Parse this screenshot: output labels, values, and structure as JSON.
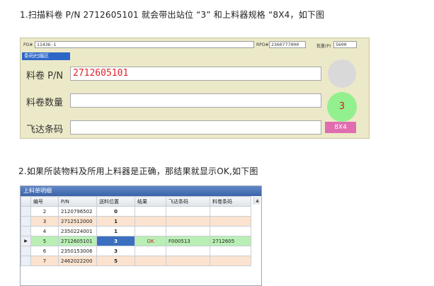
{
  "captions": {
    "step1": "1.扫描料卷 P/N 2712605101 就会带出站位 “3” 和上料器规格 “8X4，如下图",
    "step2": "2.如果所装物料及所用上料器是正确，那结果就显示OK,如下图"
  },
  "scan_panel": {
    "topbar": {
      "po_label": "PO#",
      "po_value": "11436-1",
      "rpo_label": "RPO#",
      "rpo_value": "2360777000",
      "qty_label": "批量(P)",
      "qty_value": "5600"
    },
    "section_tag": "条码扫描区",
    "fields": {
      "reel_pn_label": "料卷 P/N",
      "reel_pn_value": "2712605101",
      "reel_qty_label": "料卷数量",
      "reel_qty_value": "",
      "feeder_code_label": "飞达条码",
      "feeder_code_value": ""
    },
    "station_value": "3",
    "feeder_spec": "8X4",
    "colors": {
      "station_circle": "#93f08e",
      "spec_badge": "#e06db0",
      "section_tag": "#2e66c8"
    }
  },
  "detail_grid": {
    "title": "上料单明细",
    "columns": [
      "编号",
      "P/N",
      "送料位置",
      "结果",
      "飞达条码",
      "料卷条码"
    ],
    "rows": [
      {
        "no": "2",
        "pn": "2120796502",
        "pos": "0",
        "result": "",
        "feeder": "",
        "reel": "",
        "marker": ""
      },
      {
        "no": "3",
        "pn": "2712512000",
        "pos": "1",
        "result": "",
        "feeder": "",
        "reel": "",
        "marker": ""
      },
      {
        "no": "4",
        "pn": "2350224001",
        "pos": "1",
        "result": "",
        "feeder": "",
        "reel": "",
        "marker": ""
      },
      {
        "no": "5",
        "pn": "2712605101",
        "pos": "3",
        "result": "OK",
        "feeder": "F000513",
        "reel": "2712605",
        "marker": "▶"
      },
      {
        "no": "6",
        "pn": "2350153006",
        "pos": "3",
        "result": "",
        "feeder": "",
        "reel": "",
        "marker": ""
      },
      {
        "no": "7",
        "pn": "2462022200",
        "pos": "5",
        "result": "",
        "feeder": "",
        "reel": "",
        "marker": ""
      }
    ]
  }
}
